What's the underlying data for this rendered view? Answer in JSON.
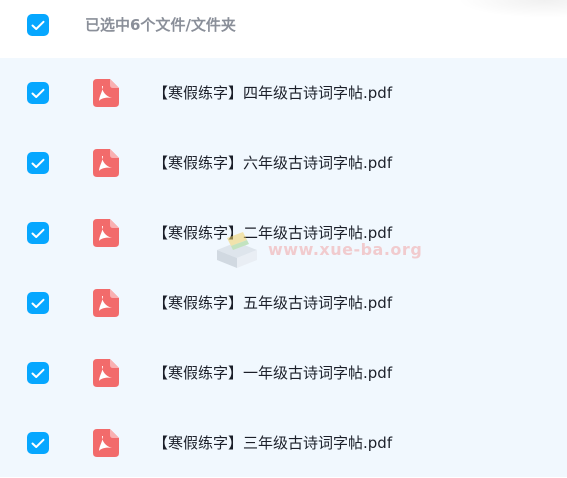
{
  "header": {
    "selection_text": "已选中6个文件/文件夹",
    "select_all_checked": true
  },
  "files": [
    {
      "name": "【寒假练字】四年级古诗词字帖.pdf",
      "checked": true,
      "icon": "pdf-icon"
    },
    {
      "name": "【寒假练字】六年级古诗词字帖.pdf",
      "checked": true,
      "icon": "pdf-icon"
    },
    {
      "name": "【寒假练字】二年级古诗词字帖.pdf",
      "checked": true,
      "icon": "pdf-icon"
    },
    {
      "name": "【寒假练字】五年级古诗词字帖.pdf",
      "checked": true,
      "icon": "pdf-icon"
    },
    {
      "name": "【寒假练字】一年级古诗词字帖.pdf",
      "checked": true,
      "icon": "pdf-icon"
    },
    {
      "name": "【寒假练字】三年级古诗词字帖.pdf",
      "checked": true,
      "icon": "pdf-icon"
    }
  ],
  "watermark": {
    "text": "www.xue-ba.org"
  },
  "colors": {
    "accent": "#06a7ff",
    "pdf_icon": "#f26b6b",
    "list_background": "#f1f8fe",
    "header_text": "#8a8f99"
  }
}
